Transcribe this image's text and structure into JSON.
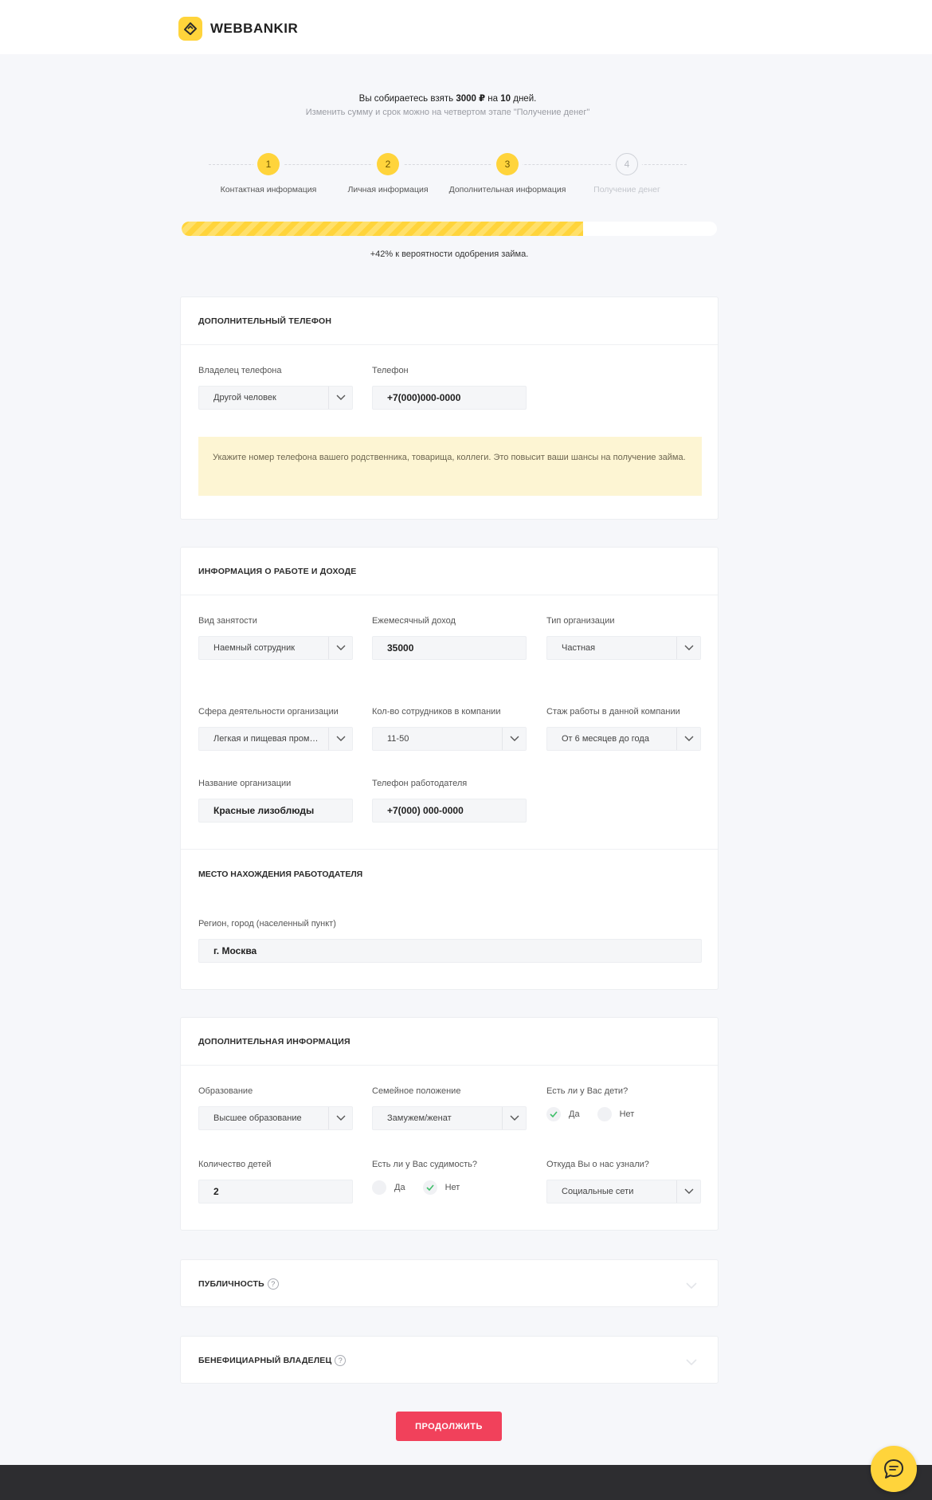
{
  "header": {
    "brand": "WEBBANKIR"
  },
  "intro": {
    "prefix": "Вы собираетесь взять",
    "amount": "3000 ₽",
    "middle": "на",
    "days": "10",
    "suffix": "дней.",
    "hint": "Изменить сумму и срок можно на четвертом этапе \"Получение денег\""
  },
  "steps": [
    {
      "number": "1",
      "label": "Контактная информация",
      "active": true
    },
    {
      "number": "2",
      "label": "Личная информация",
      "active": true
    },
    {
      "number": "3",
      "label": "Дополнительная информация",
      "active": true
    },
    {
      "number": "4",
      "label": "Получение денег",
      "active": false
    }
  ],
  "progress": {
    "percent": 75,
    "note": "+42% к вероятности одобрения займа."
  },
  "phone_section": {
    "title": "Дополнительный телефон",
    "owner_label": "Владелец телефона",
    "owner_value": "Другой человек",
    "phone_label": "Телефон",
    "phone_value": "+7(000)000-0000",
    "notice": "Укажите номер телефона вашего родственника, товарища, коллеги. Это повысит ваши шансы на получение займа."
  },
  "work_section": {
    "title": "Информация о работе и доходе",
    "employment_label": "Вид занятости",
    "employment_value": "Наемный сотрудник",
    "income_label": "Ежемесячный доход",
    "income_value": "35000",
    "org_type_label": "Тип организации",
    "org_type_value": "Частная",
    "industry_label": "Сфера деятельности организации",
    "industry_value": "Легкая и пищевая промышленность",
    "staff_label": "Кол-во сотрудников в компании",
    "staff_value": "11-50",
    "tenure_label": "Стаж работы в данной компании",
    "tenure_value": "От 6 месяцев до года",
    "org_name_label": "Название организации",
    "org_name_value": "Красные лизоблюды",
    "employer_phone_label": "Телефон работодателя",
    "employer_phone_value": "+7(000) 000-0000",
    "location_title": "Место нахождения работодателя",
    "region_label": "Регион, город (населенный пункт)",
    "region_value": "г. Москва"
  },
  "extra_section": {
    "title": "Дополнительная информация",
    "education_label": "Образование",
    "education_value": "Высшее образование",
    "marital_label": "Семейное положение",
    "marital_value": "Замужем/женат",
    "children_q_label": "Есть ли у Вас дети?",
    "children_yes": "Да",
    "children_no": "Нет",
    "children_selected": "yes",
    "children_count_label": "Количество детей",
    "children_count_value": "2",
    "criminal_label": "Есть ли у Вас судимость?",
    "criminal_yes": "Да",
    "criminal_no": "Нет",
    "criminal_selected": "no",
    "source_label": "Откуда Вы о нас узнали?",
    "source_value": "Социальные сети"
  },
  "publicity_section": {
    "title": "Публичность",
    "help": "?"
  },
  "beneficiary_section": {
    "title": "Бенефициарный владелец",
    "help": "?"
  },
  "actions": {
    "continue_label": "Продолжить"
  },
  "colors": {
    "accent": "#ffd43b",
    "button": "#f1415b",
    "notice_bg": "#fdf5d3",
    "footer": "#2d2d30"
  }
}
